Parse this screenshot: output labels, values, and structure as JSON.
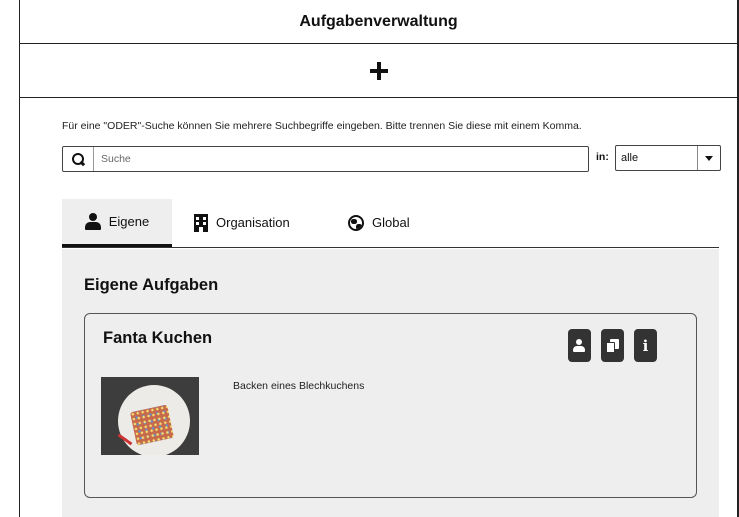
{
  "app": {
    "title": "Aufgabenverwaltung"
  },
  "toolbar": {
    "add_icon": "plus-icon"
  },
  "search": {
    "hint": "Für eine \"ODER\"-Suche können Sie mehrere Suchbegriffe eingeben. Bitte trennen Sie diese mit einem Komma.",
    "placeholder": "Suche",
    "value": "",
    "scope_label": "in:",
    "scope_value": "alle"
  },
  "tabs": [
    {
      "label": "Eigene",
      "icon": "person-icon",
      "active": true
    },
    {
      "label": "Organisation",
      "icon": "building-icon",
      "active": false
    },
    {
      "label": "Global",
      "icon": "globe-icon",
      "active": false
    }
  ],
  "panel": {
    "title": "Eigene Aufgaben",
    "cards": [
      {
        "title": "Fanta Kuchen",
        "description": "Backen eines Blechkuchens",
        "actions": [
          "person-icon",
          "copy-icon",
          "info-icon"
        ]
      }
    ]
  },
  "colors": {
    "panel_bg": "#eeeeee",
    "button_bg": "#333333",
    "border": "#222222"
  }
}
